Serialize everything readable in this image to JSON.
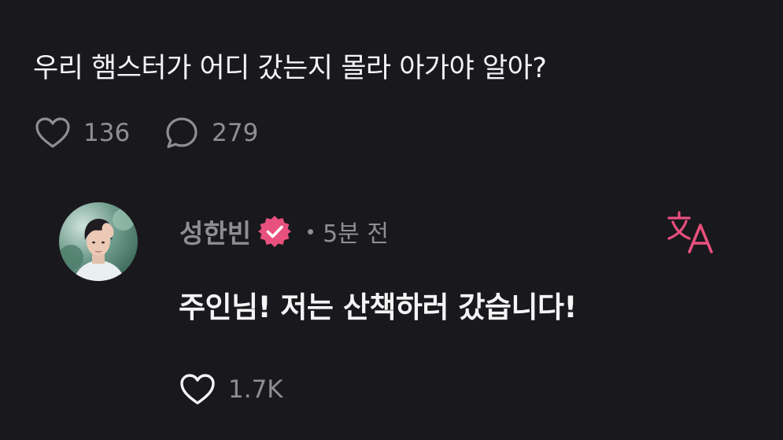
{
  "post": {
    "text": "우리 햄스터가 어디 갔는지 몰라 아가야 알아?",
    "likes": "136",
    "comments": "279"
  },
  "reply": {
    "author": "성한빈",
    "time": "5분 전",
    "text": "주인님! 저는 산책하러 갔습니다!",
    "likes": "1.7K"
  },
  "icons": {
    "like": "heart-outline-icon",
    "comment": "speech-bubble-icon",
    "verified": "verified-badge-icon",
    "translate": "translate-icon"
  },
  "colors": {
    "background": "#19181c",
    "text_primary": "#f4f4f5",
    "text_secondary": "#8e8e93",
    "accent": "#e8507e"
  }
}
